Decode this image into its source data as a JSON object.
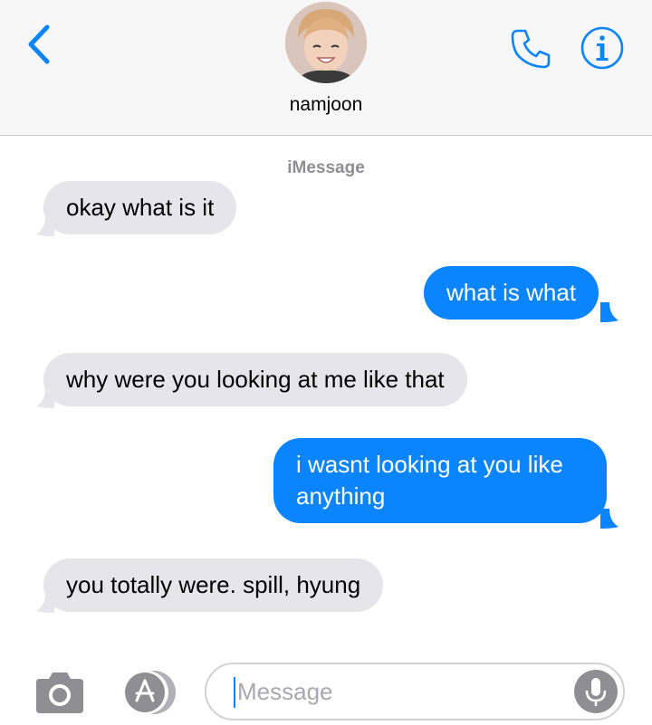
{
  "header": {
    "contact_name": "namjoon",
    "back_icon": "chevron-left-icon",
    "call_icon": "phone-icon",
    "info_icon": "info-icon"
  },
  "conversation": {
    "service_label": "iMessage",
    "messages": [
      {
        "direction": "incoming",
        "text": "okay what is it"
      },
      {
        "direction": "outgoing",
        "text": "what is what"
      },
      {
        "direction": "incoming",
        "text": "why were you looking at me like that"
      },
      {
        "direction": "outgoing",
        "lines": [
          "i wasnt looking at you like",
          "anything"
        ]
      },
      {
        "direction": "incoming",
        "text": "you totally were. spill, hyung"
      }
    ]
  },
  "composer": {
    "placeholder": "Message",
    "camera_icon": "camera-icon",
    "apps_icon": "app-store-icon",
    "mic_icon": "microphone-icon"
  },
  "colors": {
    "accent": "#0b84ff",
    "incoming_bubble": "#e5e5ea",
    "header_bg": "#f7f7f7"
  }
}
